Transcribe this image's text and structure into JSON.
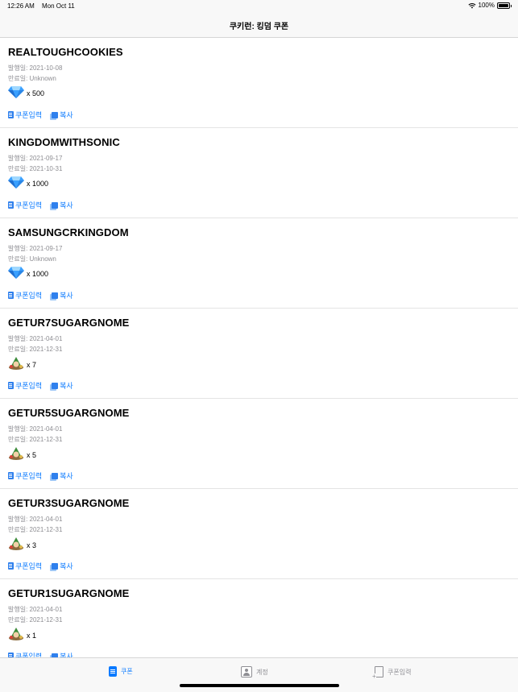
{
  "status_bar": {
    "time": "12:26 AM",
    "date": "Mon Oct 11",
    "battery": "100%"
  },
  "nav": {
    "title": "쿠키런: 킹덤 쿠폰"
  },
  "labels": {
    "issued_prefix": "발행일: ",
    "expiry_prefix": "만료일: ",
    "enter_coupon": "쿠폰입력",
    "copy": "복사"
  },
  "coupons": [
    {
      "code": "REALTOUGHCOOKIES",
      "issued": "발행일: 2021-10-08",
      "expiry": "만료일: Unknown",
      "reward_icon": "crystal-icon",
      "quantity": "x 500"
    },
    {
      "code": "KINGDOMWITHSONIC",
      "issued": "발행일: 2021-09-17",
      "expiry": "만료일: 2021-10-31",
      "reward_icon": "crystal-icon",
      "quantity": "x 1000"
    },
    {
      "code": "SAMSUNGCRKINGDOM",
      "issued": "발행일: 2021-09-17",
      "expiry": "만료일: Unknown",
      "reward_icon": "crystal-icon",
      "quantity": "x 1000"
    },
    {
      "code": "GETUR7SUGARGNOME",
      "issued": "발행일: 2021-04-01",
      "expiry": "만료일: 2021-12-31",
      "reward_icon": "sugar-gnome-icon",
      "quantity": "x 7"
    },
    {
      "code": "GETUR5SUGARGNOME",
      "issued": "발행일: 2021-04-01",
      "expiry": "만료일: 2021-12-31",
      "reward_icon": "sugar-gnome-icon",
      "quantity": "x 5"
    },
    {
      "code": "GETUR3SUGARGNOME",
      "issued": "발행일: 2021-04-01",
      "expiry": "만료일: 2021-12-31",
      "reward_icon": "sugar-gnome-icon",
      "quantity": "x 3"
    },
    {
      "code": "GETUR1SUGARGNOME",
      "issued": "발행일: 2021-04-01",
      "expiry": "만료일: 2021-12-31",
      "reward_icon": "sugar-gnome-icon",
      "quantity": "x 1"
    }
  ],
  "tabs": [
    {
      "label": "쿠폰",
      "icon": "coupon-doc-icon",
      "active": true
    },
    {
      "label": "계정",
      "icon": "account-icon",
      "active": false
    },
    {
      "label": "쿠폰입력",
      "icon": "enter-coupon-icon",
      "active": false
    }
  ],
  "colors": {
    "accent": "#0a7aff",
    "secondary_text": "#8e8e93",
    "crystal": "#3aa0ff"
  }
}
